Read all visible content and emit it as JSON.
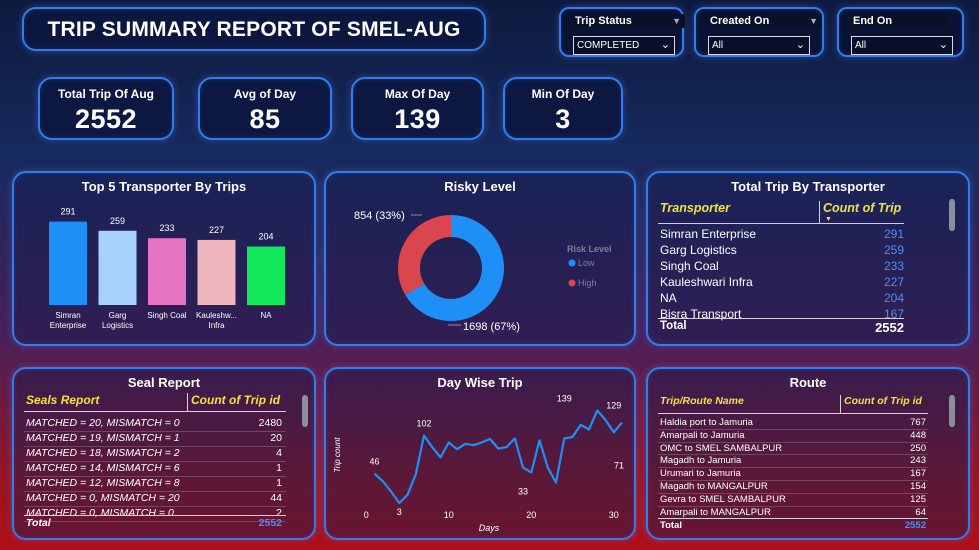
{
  "title": "TRIP SUMMARY REPORT OF SMEL-AUG",
  "slicers": [
    {
      "label": "Trip Status",
      "value": "COMPLETED"
    },
    {
      "label": "Created On",
      "value": "All"
    },
    {
      "label": "End On",
      "value": "All"
    }
  ],
  "kpis": [
    {
      "label": "Total Trip Of Aug",
      "value": "2552"
    },
    {
      "label": "Avg of Day",
      "value": "85"
    },
    {
      "label": "Max Of Day",
      "value": "139"
    },
    {
      "label": "Min Of Day",
      "value": "3"
    }
  ],
  "top5": {
    "title": "Top 5 Transporter By Trips",
    "items": [
      {
        "label": "Simran Enterprise",
        "value": 291,
        "color": "#1f8ff8"
      },
      {
        "label": "Garg Logistics",
        "value": 259,
        "color": "#a5d1fb"
      },
      {
        "label": "Singh Coal",
        "value": 233,
        "color": "#e773c4"
      },
      {
        "label": "Kauleshw... Infra",
        "value": 227,
        "color": "#f0b6bd"
      },
      {
        "label": "NA",
        "value": 204,
        "color": "#12e85c"
      }
    ]
  },
  "risky": {
    "title": "Risky Level",
    "legend_title": "Risk Level",
    "slices": [
      {
        "name": "Low",
        "value": 1698,
        "label": "1698 (67%)",
        "color": "#1f8ff8"
      },
      {
        "name": "High",
        "value": 854,
        "label": "854 (33%)",
        "color": "#d9464d"
      }
    ]
  },
  "transporter_table": {
    "title": "Total Trip By Transporter",
    "col1": "Transporter",
    "col2": "Count of Trip",
    "rows": [
      {
        "name": "Simran Enterprise",
        "count": "291"
      },
      {
        "name": "Garg Logistics",
        "count": "259"
      },
      {
        "name": "Singh Coal",
        "count": "233"
      },
      {
        "name": "Kauleshwari Infra",
        "count": "227"
      },
      {
        "name": "NA",
        "count": "204"
      },
      {
        "name": "Bisra Transport",
        "count": "167"
      }
    ],
    "total_label": "Total",
    "total": "2552"
  },
  "seal_table": {
    "title": "Seal Report",
    "col1": "Seals Report",
    "col2": "Count of Trip id",
    "rows": [
      {
        "name": "MATCHED = 20, MISMATCH = 0",
        "count": "2480"
      },
      {
        "name": "MATCHED = 19, MISMATCH = 1",
        "count": "20"
      },
      {
        "name": "MATCHED = 18, MISMATCH = 2",
        "count": "4"
      },
      {
        "name": "MATCHED = 14, MISMATCH = 6",
        "count": "1"
      },
      {
        "name": "MATCHED = 12, MISMATCH = 8",
        "count": "1"
      },
      {
        "name": "MATCHED = 0, MISMATCH = 20",
        "count": "44"
      },
      {
        "name": "MATCHED = 0, MISMATCH = 0",
        "count": "2"
      }
    ],
    "total_label": "Total",
    "total": "2552"
  },
  "route_table": {
    "title": "Route",
    "col1": "Trip/Route Name",
    "col2": "Count of Trip id",
    "rows": [
      {
        "name": "Haldia port to Jamuria",
        "count": "767"
      },
      {
        "name": "Amarpali to Jamuria",
        "count": "448"
      },
      {
        "name": "OMC to SMEL SAMBALPUR",
        "count": "250"
      },
      {
        "name": "Magadh to Jamuria",
        "count": "243"
      },
      {
        "name": "Urumari to Jamuria",
        "count": "167"
      },
      {
        "name": "Magadh to MANGALPUR",
        "count": "154"
      },
      {
        "name": "Gevra to SMEL SAMBALPUR",
        "count": "125"
      },
      {
        "name": "Amarpali to MANGALPUR",
        "count": "64"
      }
    ],
    "total_label": "Total",
    "total": "2552"
  },
  "chart_data": [
    {
      "type": "bar",
      "title": "Top 5 Transporter By Trips",
      "categories": [
        "Simran Enterprise",
        "Garg Logistics",
        "Singh Coal",
        "Kauleshw... Infra",
        "NA"
      ],
      "values": [
        291,
        259,
        233,
        227,
        204
      ]
    },
    {
      "type": "pie",
      "title": "Risky Level",
      "categories": [
        "Low",
        "High"
      ],
      "values": [
        1698,
        854
      ]
    },
    {
      "type": "line",
      "title": "Day Wise Trip",
      "xlabel": "Days",
      "ylabel": "Trip count",
      "xticks": [
        0,
        10,
        20,
        30
      ],
      "xlim": [
        -1,
        31
      ],
      "ylim": [
        0,
        150
      ],
      "x": [
        1,
        2,
        3,
        4,
        5,
        6,
        7,
        8,
        9,
        10,
        11,
        12,
        13,
        14,
        15,
        16,
        17,
        18,
        19,
        20,
        21,
        22,
        23,
        24,
        25,
        26,
        27,
        28,
        29,
        30,
        31
      ],
      "values": [
        46,
        35,
        20,
        3,
        15,
        45,
        102,
        85,
        70,
        92,
        82,
        90,
        88,
        92,
        97,
        83,
        85,
        98,
        55,
        48,
        95,
        55,
        33,
        98,
        100,
        118,
        111,
        139,
        125,
        107,
        121
      ],
      "labeled_points": [
        {
          "x": 1,
          "y": 46,
          "label": "46"
        },
        {
          "x": 4,
          "y": 3,
          "label": "3"
        },
        {
          "x": 7,
          "y": 102,
          "label": "102"
        },
        {
          "x": 19,
          "y": 33,
          "label": "33"
        },
        {
          "x": 24,
          "y": 139,
          "label": "139"
        },
        {
          "x": 30,
          "y": 129,
          "label": "129"
        },
        {
          "x": 31,
          "y": 71,
          "label": "71"
        }
      ]
    }
  ]
}
